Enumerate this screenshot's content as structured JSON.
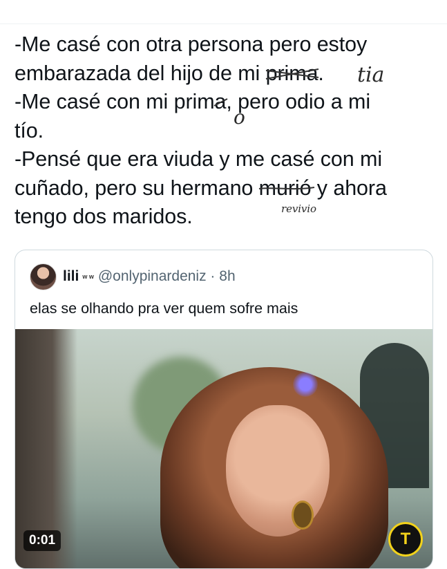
{
  "post": {
    "line1": "-Me casé con otra persona pero estoy",
    "line2_pre": "embarazada del hijo de mi ",
    "line2_struck": "prima",
    "line2_post": ".",
    "line2_hand": "tia",
    "line3_pre": "-Me casé con mi prim",
    "line3_struck": "a",
    "line3_post": ", pero odio a mi",
    "line3_hand": "o",
    "line4": "tío.",
    "line5": "-Pensé que era viuda y me casé con mi",
    "line6_pre": "cuñado, pero su hermano ",
    "line6_struck": "murió",
    "line6_post": " y ahora",
    "line6_hand": "revivio",
    "line7": "tengo dos maridos."
  },
  "quote": {
    "name": "lili",
    "verified_glyph": "w w",
    "handle": "@onlypinardeniz · 8h",
    "text": "elas se olhando pra ver quem sofre mais",
    "media_timer": "0:01",
    "media_badge": "T"
  }
}
